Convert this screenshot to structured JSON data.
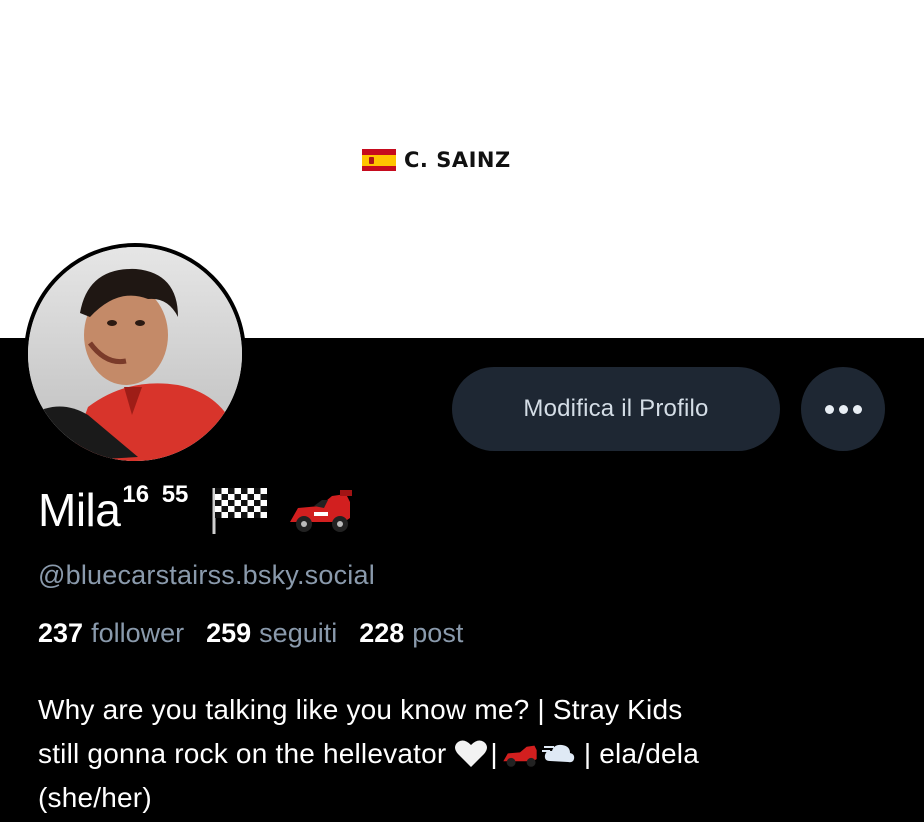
{
  "banner": {
    "logo_text": "C. SAINZ"
  },
  "profile": {
    "display_name": "Mila",
    "name_superscript": "16 55",
    "name_emojis": [
      "checkered-flag-icon",
      "race-car-icon"
    ],
    "handle": "@bluecarstairss.bsky.social"
  },
  "actions": {
    "edit_label": "Modifica il Profilo"
  },
  "stats": [
    {
      "value": "237",
      "label": "follower"
    },
    {
      "value": "259",
      "label": "seguiti"
    },
    {
      "value": "228",
      "label": "post"
    }
  ],
  "bio": {
    "line1": "Why are you talking like you know me? | Stray Kids",
    "line2_pre": "still gonna rock on the hellevator",
    "line2_sep": "|",
    "line2_sep2": "| ela/dela",
    "line3": "(she/her)"
  },
  "colors": {
    "accent_button_bg": "#1e2733",
    "muted_text": "#8a9aac",
    "background": "#000000"
  }
}
